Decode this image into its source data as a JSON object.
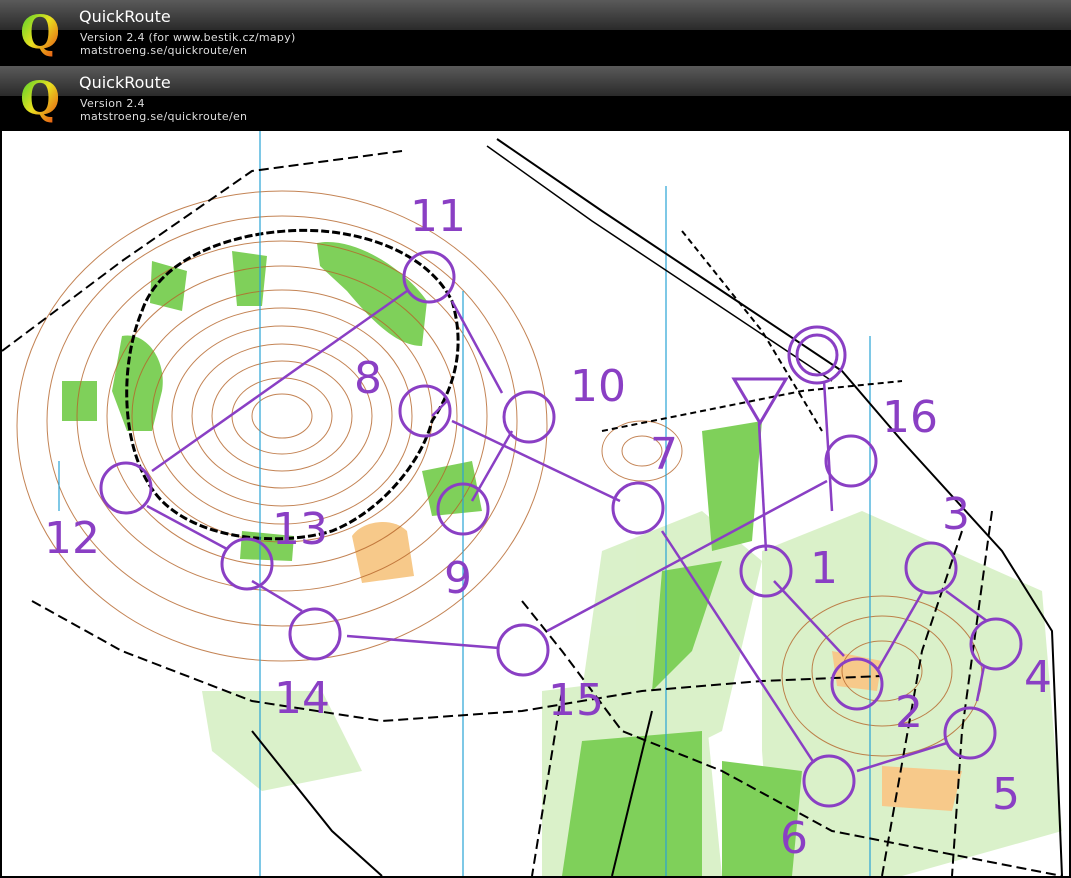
{
  "banners": [
    {
      "title": "QuickRoute",
      "line1": "Version 2.4  (for www.bestik.cz/mapy)",
      "line2": "matstroeng.se/quickroute/en"
    },
    {
      "title": "QuickRoute",
      "line1": "Version 2.4",
      "line2": "matstroeng.se/quickroute/en"
    }
  ],
  "logo_letter": "Q",
  "course": {
    "start_icon": "triangle-start-icon",
    "control_numbers": [
      "1",
      "2",
      "3",
      "4",
      "5",
      "6",
      "7",
      "8",
      "9",
      "10",
      "11",
      "12",
      "13",
      "14",
      "15",
      "16"
    ]
  },
  "colors": {
    "course": "#8a3fc4",
    "vegetation": "#8fd46a",
    "contour": "#b5652a",
    "track": "#000000"
  }
}
